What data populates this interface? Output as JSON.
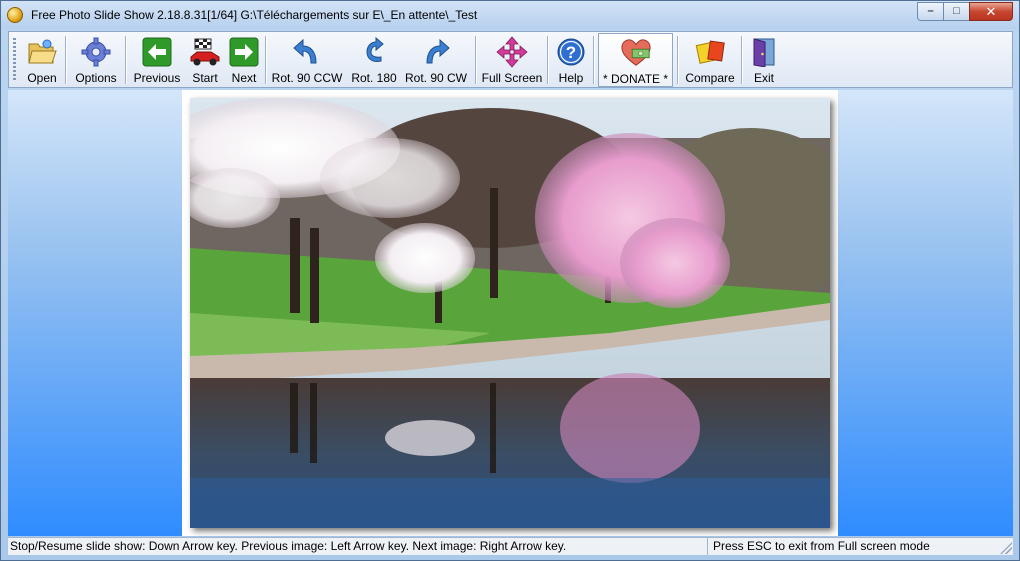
{
  "window": {
    "title": "Free Photo Slide Show 2.18.8.31[1/64] G:\\Téléchargements sur E\\_En attente\\_Test",
    "minimize_glyph": "–",
    "maximize_glyph": "□",
    "close_glyph": "✕"
  },
  "toolbar": {
    "open": "Open",
    "options": "Options",
    "previous": "Previous",
    "start": "Start",
    "next": "Next",
    "rot_ccw": "Rot. 90 CCW",
    "rot_180": "Rot. 180",
    "rot_cw": "Rot. 90 CW",
    "full_screen": "Full Screen",
    "help": "Help",
    "donate": "* DONATE *",
    "compare": "Compare",
    "exit": "Exit"
  },
  "icons": {
    "open": "folder-open-icon",
    "options": "gear-icon",
    "previous": "arrow-left-icon",
    "start": "race-car-icon",
    "next": "arrow-right-icon",
    "rot_ccw": "rotate-ccw-icon",
    "rot_180": "rotate-180-icon",
    "rot_cw": "rotate-cw-icon",
    "full_screen": "fullscreen-arrows-icon",
    "help": "help-icon",
    "donate": "heart-money-icon",
    "compare": "compare-cards-icon",
    "exit": "exit-door-icon"
  },
  "colors": {
    "toolbar_green": "#2f9a2a",
    "toolbar_blue": "#3b7fd0",
    "content_bottom": "#2f8cff"
  },
  "status": {
    "hint": "Stop/Resume slide show: Down Arrow key. Previous image: Left Arrow key. Next image: Right Arrow key.",
    "fullscreen_hint": "Press ESC to exit from Full screen mode"
  }
}
